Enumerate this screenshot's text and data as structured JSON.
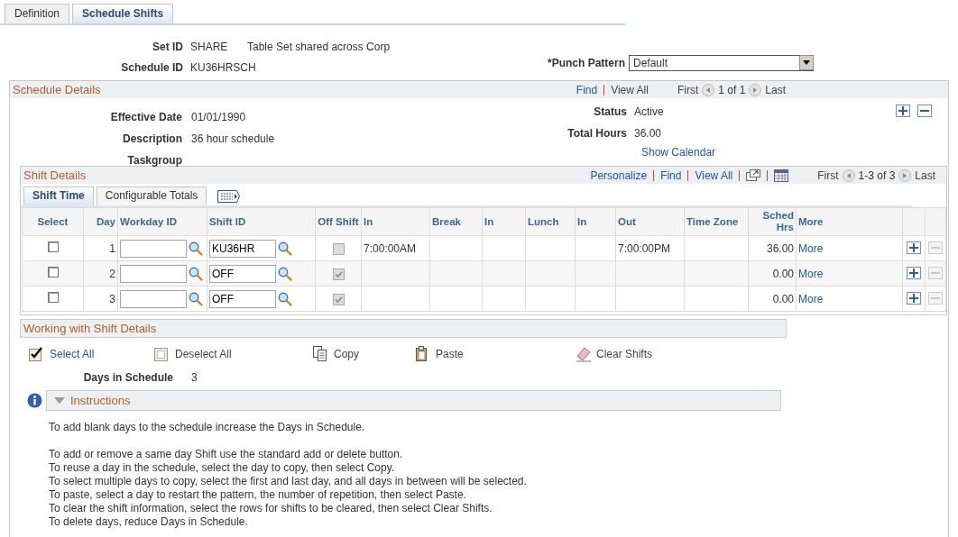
{
  "page_tabs": [
    {
      "label": "Definition",
      "selected": false
    },
    {
      "label": "Schedule Shifts",
      "selected": true
    }
  ],
  "header": {
    "set_id": {
      "label": "Set ID",
      "value": "SHARE",
      "description": "Table Set shared across Corp"
    },
    "schedule_id": {
      "label": "Schedule ID",
      "value": "KU36HRSCH"
    },
    "punch_pattern": {
      "label": "*Punch Pattern",
      "value": "Default"
    }
  },
  "schedule_details": {
    "title": "Schedule Details",
    "nav": {
      "links": [
        "Find",
        "View All"
      ],
      "first": "First",
      "range": "1 of 1",
      "last": "Last"
    },
    "fields_left": [
      {
        "label": "Effective Date",
        "value": "01/01/1990"
      },
      {
        "label": "Description",
        "value": "36 hour schedule"
      },
      {
        "label": "Taskgroup"
      }
    ],
    "fields_right": [
      {
        "label": "Status",
        "value": "Active"
      },
      {
        "label": "Total Hours",
        "value": "36.00"
      }
    ],
    "show_calendar": "Show Calendar",
    "shift_details": {
      "title": "Shift Details",
      "nav": {
        "links": [
          "Personalize",
          "Find",
          "View All"
        ],
        "first": "First",
        "range": "1-3 of 3",
        "last": "Last"
      },
      "tabs": [
        {
          "label": "Shift Time",
          "selected": true
        },
        {
          "label": "Configurable Totals",
          "selected": false
        }
      ],
      "columns": [
        {
          "label": "Select"
        },
        {
          "label": "Day"
        },
        {
          "label": "Workday ID"
        },
        {
          "label": "Shift ID"
        },
        {
          "label": "Off Shift"
        },
        {
          "label": "In"
        },
        {
          "label": "Break"
        },
        {
          "label": "In"
        },
        {
          "label": "Lunch"
        },
        {
          "label": "In"
        },
        {
          "label": "Out"
        },
        {
          "label": "Time Zone"
        },
        {
          "label": "Sched Hrs"
        },
        {
          "label": "More"
        }
      ],
      "rows": [
        {
          "selected": false,
          "day": "1",
          "shift_id": "KU36HR",
          "off_shift": false,
          "in": "7:00:00AM",
          "out": "7:00:00PM",
          "sched_hrs": "36.00",
          "more": "More",
          "delete_enabled": false
        },
        {
          "selected": false,
          "day": "2",
          "shift_id": "OFF",
          "off_shift": true,
          "sched_hrs": "0.00",
          "more": "More",
          "delete_enabled": false
        },
        {
          "selected": false,
          "day": "3",
          "shift_id": "OFF",
          "off_shift": true,
          "sched_hrs": "0.00",
          "more": "More",
          "delete_enabled": false
        }
      ]
    },
    "working": {
      "title": "Working with Shift Details",
      "actions": [
        {
          "kind": "select_all",
          "label": "Select All"
        },
        {
          "kind": "deselect_all",
          "label": "Deselect All"
        },
        {
          "kind": "copy",
          "label": "Copy"
        },
        {
          "kind": "paste",
          "label": "Paste"
        },
        {
          "kind": "clear",
          "label": "Clear Shifts"
        }
      ],
      "days": {
        "label": "Days in Schedule",
        "value": "3"
      }
    },
    "instructions": {
      "title": "Instructions",
      "expanded": true,
      "paragraphs": [
        [
          "To add blank days to the schedule increase the Days in Schedule."
        ],
        [
          "To add or remove a same day Shift use the standard add or delete button.",
          "To reuse a day in the schedule, select the day to copy, then select Copy.",
          "To select multiple days to copy, select the first and last day, and all days in between will be selected.",
          "To paste, select a day to restart the pattern, the number of repetition, then select Paste.",
          "To clear the shift information, select the rows for shifts to be cleared, then select Clear Shifts.",
          "To delete days, reduce Days in Schedule."
        ]
      ]
    }
  }
}
